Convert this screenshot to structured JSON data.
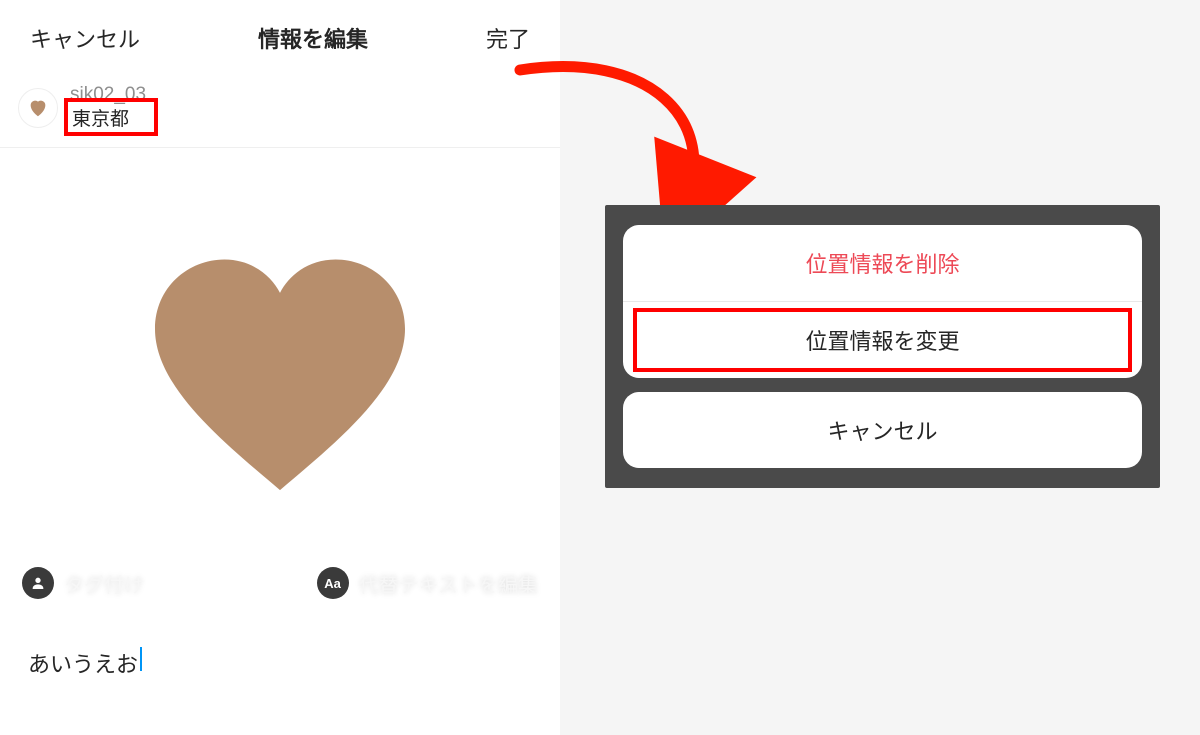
{
  "nav": {
    "cancel": "キャンセル",
    "title": "情報を編集",
    "done": "完了"
  },
  "user": {
    "username": "sik02_03",
    "location": "東京都"
  },
  "overlay": {
    "tag_label": "タグ付け",
    "alt_label": "代替テキストを編集",
    "alt_icon_text": "Aa"
  },
  "caption": {
    "text": "あいうえお"
  },
  "sheet": {
    "remove_location": "位置情報を削除",
    "change_location": "位置情報を変更",
    "cancel": "キャンセル"
  },
  "colors": {
    "heart": "#b78e6c",
    "highlight": "#ff0000",
    "destructive": "#ed4956"
  }
}
